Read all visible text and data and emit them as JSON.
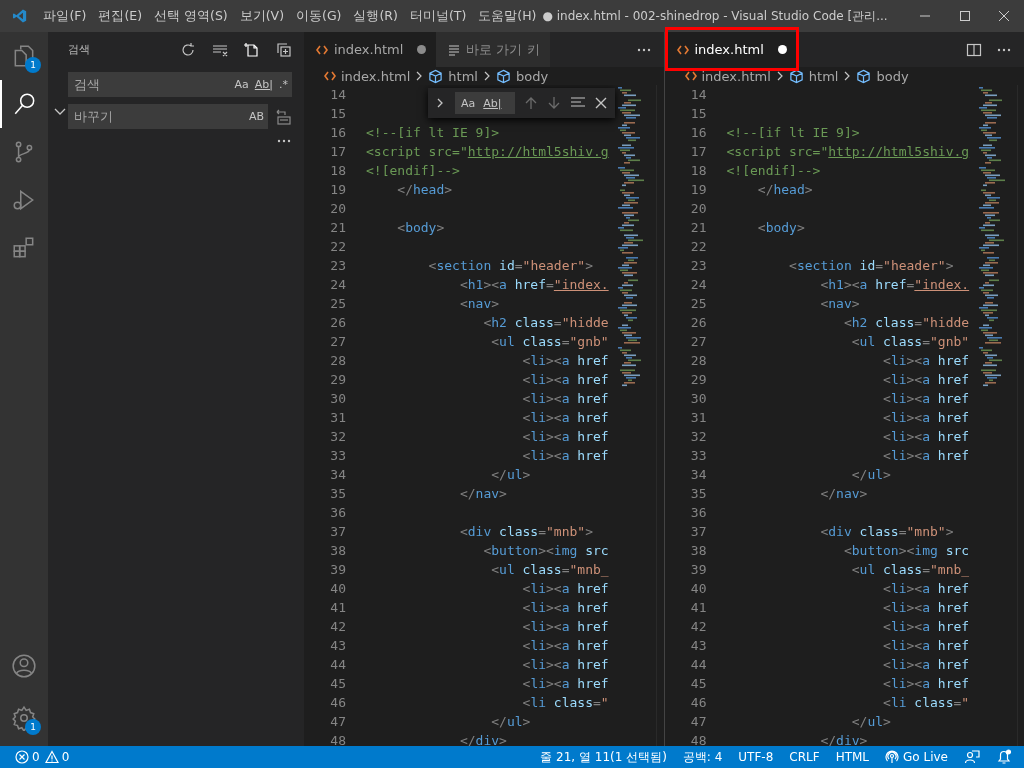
{
  "window": {
    "title": "● index.html - 002-shinedrop - Visual Studio Code [관리...",
    "menus": [
      "파일(F)",
      "편집(E)",
      "선택 영역(S)",
      "보기(V)",
      "이동(G)",
      "실행(R)",
      "터미널(T)",
      "도움말(H)"
    ]
  },
  "activity_bar": {
    "items": [
      {
        "kind": "explorer",
        "selected": false,
        "badge": "1"
      },
      {
        "kind": "search",
        "selected": true
      },
      {
        "kind": "source-control",
        "selected": false
      },
      {
        "kind": "run",
        "selected": false
      },
      {
        "kind": "extensions",
        "selected": false
      }
    ],
    "bottom": [
      {
        "kind": "account",
        "selected": false
      },
      {
        "kind": "settings",
        "selected": false,
        "badge": "1"
      }
    ]
  },
  "sidebar": {
    "title": "검색",
    "replace_expanded": true,
    "search": {
      "placeholder": "검색",
      "options": [
        "Aa",
        "Ab|",
        ".*"
      ]
    },
    "replace": {
      "placeholder": "바꾸기",
      "options": [
        "AB"
      ]
    }
  },
  "editor_groups": [
    {
      "focused": false,
      "tabs": [
        {
          "label": "index.html",
          "kind": "html",
          "selected": true,
          "dirty": true,
          "highlighted": false
        },
        {
          "label": "바로 가기 키",
          "kind": "shortcuts",
          "selected": false,
          "dirty": false,
          "highlighted": false
        }
      ],
      "breadcrumbs": [
        {
          "label": "index.html",
          "kind": "file"
        },
        {
          "label": "html",
          "kind": "element"
        },
        {
          "label": "body",
          "kind": "element"
        }
      ],
      "find_widget": {
        "expanded": false,
        "options": [
          "Aa",
          "Ab|"
        ]
      },
      "lines": [
        {
          "number": "14"
        },
        {
          "number": "15"
        },
        {
          "number": "16",
          "segments": [
            {
              "kind": "comment",
              "text": "<!--[if lt IE 9]>"
            }
          ]
        },
        {
          "number": "17",
          "segments": [
            {
              "kind": "comment",
              "text": "<script src=\""
            },
            {
              "kind": "link",
              "text": "http://html5shiv.g"
            }
          ]
        },
        {
          "number": "18",
          "segments": [
            {
              "kind": "comment",
              "text": "<![endif]-->"
            }
          ]
        },
        {
          "number": "19",
          "segments": [
            {
              "kind": "punct",
              "text": "    </"
            },
            {
              "kind": "tag",
              "text": "head"
            },
            {
              "kind": "punct",
              "text": ">"
            }
          ]
        },
        {
          "number": "20"
        },
        {
          "number": "21",
          "segments": [
            {
              "kind": "punct",
              "text": "    <"
            },
            {
              "kind": "tag",
              "text": "body"
            },
            {
              "kind": "punct",
              "text": ">"
            }
          ]
        },
        {
          "number": "22"
        },
        {
          "number": "23",
          "segments": [
            {
              "kind": "punct",
              "text": "        <"
            },
            {
              "kind": "tag",
              "text": "section"
            },
            {
              "kind": "attr",
              "text": " id"
            },
            {
              "kind": "punct",
              "text": "="
            },
            {
              "kind": "string",
              "text": "\"header\""
            },
            {
              "kind": "punct",
              "text": ">"
            }
          ]
        },
        {
          "number": "24",
          "segments": [
            {
              "kind": "punct",
              "text": "            <"
            },
            {
              "kind": "tag",
              "text": "h1"
            },
            {
              "kind": "punct",
              "text": "><"
            },
            {
              "kind": "tag",
              "text": "a"
            },
            {
              "kind": "attr",
              "text": " href"
            },
            {
              "kind": "punct",
              "text": "="
            },
            {
              "kind": "link-string",
              "text": "\"index."
            }
          ]
        },
        {
          "number": "25",
          "segments": [
            {
              "kind": "punct",
              "text": "            <"
            },
            {
              "kind": "tag",
              "text": "nav"
            },
            {
              "kind": "punct",
              "text": ">"
            }
          ]
        },
        {
          "number": "26",
          "segments": [
            {
              "kind": "punct",
              "text": "               <"
            },
            {
              "kind": "tag",
              "text": "h2"
            },
            {
              "kind": "attr",
              "text": " class"
            },
            {
              "kind": "punct",
              "text": "="
            },
            {
              "kind": "string",
              "text": "\"hidde"
            }
          ]
        },
        {
          "number": "27",
          "segments": [
            {
              "kind": "punct",
              "text": "                <"
            },
            {
              "kind": "tag",
              "text": "ul"
            },
            {
              "kind": "attr",
              "text": " class"
            },
            {
              "kind": "punct",
              "text": "="
            },
            {
              "kind": "string",
              "text": "\"gnb\""
            }
          ]
        },
        {
          "number": "28",
          "segments": [
            {
              "kind": "punct",
              "text": "                    <"
            },
            {
              "kind": "tag",
              "text": "li"
            },
            {
              "kind": "punct",
              "text": "><"
            },
            {
              "kind": "tag",
              "text": "a"
            },
            {
              "kind": "attr",
              "text": " href"
            }
          ]
        },
        {
          "number": "29",
          "segments": [
            {
              "kind": "punct",
              "text": "                    <"
            },
            {
              "kind": "tag",
              "text": "li"
            },
            {
              "kind": "punct",
              "text": "><"
            },
            {
              "kind": "tag",
              "text": "a"
            },
            {
              "kind": "attr",
              "text": " href"
            }
          ]
        },
        {
          "number": "30",
          "segments": [
            {
              "kind": "punct",
              "text": "                    <"
            },
            {
              "kind": "tag",
              "text": "li"
            },
            {
              "kind": "punct",
              "text": "><"
            },
            {
              "kind": "tag",
              "text": "a"
            },
            {
              "kind": "attr",
              "text": " href"
            }
          ]
        },
        {
          "number": "31",
          "segments": [
            {
              "kind": "punct",
              "text": "                    <"
            },
            {
              "kind": "tag",
              "text": "li"
            },
            {
              "kind": "punct",
              "text": "><"
            },
            {
              "kind": "tag",
              "text": "a"
            },
            {
              "kind": "attr",
              "text": " href"
            }
          ]
        },
        {
          "number": "32",
          "segments": [
            {
              "kind": "punct",
              "text": "                    <"
            },
            {
              "kind": "tag",
              "text": "li"
            },
            {
              "kind": "punct",
              "text": "><"
            },
            {
              "kind": "tag",
              "text": "a"
            },
            {
              "kind": "attr",
              "text": " href"
            }
          ]
        },
        {
          "number": "33",
          "segments": [
            {
              "kind": "punct",
              "text": "                    <"
            },
            {
              "kind": "tag",
              "text": "li"
            },
            {
              "kind": "punct",
              "text": "><"
            },
            {
              "kind": "tag",
              "text": "a"
            },
            {
              "kind": "attr",
              "text": " href"
            }
          ]
        },
        {
          "number": "34",
          "segments": [
            {
              "kind": "punct",
              "text": "                </"
            },
            {
              "kind": "tag",
              "text": "ul"
            },
            {
              "kind": "punct",
              "text": ">"
            }
          ]
        },
        {
          "number": "35",
          "segments": [
            {
              "kind": "punct",
              "text": "            </"
            },
            {
              "kind": "tag",
              "text": "nav"
            },
            {
              "kind": "punct",
              "text": ">"
            }
          ]
        },
        {
          "number": "36"
        },
        {
          "number": "37",
          "segments": [
            {
              "kind": "punct",
              "text": "            <"
            },
            {
              "kind": "tag",
              "text": "div"
            },
            {
              "kind": "attr",
              "text": " class"
            },
            {
              "kind": "punct",
              "text": "="
            },
            {
              "kind": "string",
              "text": "\"mnb\""
            },
            {
              "kind": "punct",
              "text": ">"
            }
          ]
        },
        {
          "number": "38",
          "segments": [
            {
              "kind": "punct",
              "text": "               <"
            },
            {
              "kind": "tag",
              "text": "button"
            },
            {
              "kind": "punct",
              "text": "><"
            },
            {
              "kind": "tag",
              "text": "img"
            },
            {
              "kind": "attr",
              "text": " src"
            }
          ]
        },
        {
          "number": "39",
          "segments": [
            {
              "kind": "punct",
              "text": "                <"
            },
            {
              "kind": "tag",
              "text": "ul"
            },
            {
              "kind": "attr",
              "text": " class"
            },
            {
              "kind": "punct",
              "text": "="
            },
            {
              "kind": "string",
              "text": "\"mnb_"
            }
          ]
        },
        {
          "number": "40",
          "segments": [
            {
              "kind": "punct",
              "text": "                    <"
            },
            {
              "kind": "tag",
              "text": "li"
            },
            {
              "kind": "punct",
              "text": "><"
            },
            {
              "kind": "tag",
              "text": "a"
            },
            {
              "kind": "attr",
              "text": " href"
            }
          ]
        },
        {
          "number": "41",
          "segments": [
            {
              "kind": "punct",
              "text": "                    <"
            },
            {
              "kind": "tag",
              "text": "li"
            },
            {
              "kind": "punct",
              "text": "><"
            },
            {
              "kind": "tag",
              "text": "a"
            },
            {
              "kind": "attr",
              "text": " href"
            }
          ]
        },
        {
          "number": "42",
          "segments": [
            {
              "kind": "punct",
              "text": "                    <"
            },
            {
              "kind": "tag",
              "text": "li"
            },
            {
              "kind": "punct",
              "text": "><"
            },
            {
              "kind": "tag",
              "text": "a"
            },
            {
              "kind": "attr",
              "text": " href"
            }
          ]
        },
        {
          "number": "43",
          "segments": [
            {
              "kind": "punct",
              "text": "                    <"
            },
            {
              "kind": "tag",
              "text": "li"
            },
            {
              "kind": "punct",
              "text": "><"
            },
            {
              "kind": "tag",
              "text": "a"
            },
            {
              "kind": "attr",
              "text": " href"
            }
          ]
        },
        {
          "number": "44",
          "segments": [
            {
              "kind": "punct",
              "text": "                    <"
            },
            {
              "kind": "tag",
              "text": "li"
            },
            {
              "kind": "punct",
              "text": "><"
            },
            {
              "kind": "tag",
              "text": "a"
            },
            {
              "kind": "attr",
              "text": " href"
            }
          ]
        },
        {
          "number": "45",
          "segments": [
            {
              "kind": "punct",
              "text": "                    <"
            },
            {
              "kind": "tag",
              "text": "li"
            },
            {
              "kind": "punct",
              "text": "><"
            },
            {
              "kind": "tag",
              "text": "a"
            },
            {
              "kind": "attr",
              "text": " href"
            }
          ]
        },
        {
          "number": "46",
          "segments": [
            {
              "kind": "punct",
              "text": "                    <"
            },
            {
              "kind": "tag",
              "text": "li"
            },
            {
              "kind": "attr",
              "text": " class"
            },
            {
              "kind": "punct",
              "text": "="
            },
            {
              "kind": "string",
              "text": "\""
            }
          ]
        },
        {
          "number": "47",
          "segments": [
            {
              "kind": "punct",
              "text": "                </"
            },
            {
              "kind": "tag",
              "text": "ul"
            },
            {
              "kind": "punct",
              "text": ">"
            }
          ]
        },
        {
          "number": "48",
          "segments": [
            {
              "kind": "punct",
              "text": "            </"
            },
            {
              "kind": "tag",
              "text": "div"
            },
            {
              "kind": "punct",
              "text": ">"
            }
          ]
        }
      ]
    },
    {
      "focused": true,
      "tabs": [
        {
          "label": "index.html",
          "kind": "html",
          "selected": true,
          "dirty": true,
          "highlighted": true
        }
      ],
      "breadcrumbs": [
        {
          "label": "index.html",
          "kind": "file"
        },
        {
          "label": "html",
          "kind": "element"
        },
        {
          "label": "body",
          "kind": "element"
        }
      ],
      "lines": [
        {
          "number": "14"
        },
        {
          "number": "15"
        },
        {
          "number": "16",
          "segments": [
            {
              "kind": "comment",
              "text": "<!--[if lt IE 9]>"
            }
          ]
        },
        {
          "number": "17",
          "segments": [
            {
              "kind": "comment",
              "text": "<script src=\""
            },
            {
              "kind": "link",
              "text": "http://html5shiv.g"
            }
          ]
        },
        {
          "number": "18",
          "segments": [
            {
              "kind": "comment",
              "text": "<![endif]-->"
            }
          ]
        },
        {
          "number": "19",
          "segments": [
            {
              "kind": "punct",
              "text": "    </"
            },
            {
              "kind": "tag",
              "text": "head"
            },
            {
              "kind": "punct",
              "text": ">"
            }
          ]
        },
        {
          "number": "20"
        },
        {
          "number": "21",
          "segments": [
            {
              "kind": "punct",
              "text": "    <"
            },
            {
              "kind": "tag",
              "text": "body"
            },
            {
              "kind": "punct",
              "text": ">"
            }
          ]
        },
        {
          "number": "22"
        },
        {
          "number": "23",
          "segments": [
            {
              "kind": "punct",
              "text": "        <"
            },
            {
              "kind": "tag",
              "text": "section"
            },
            {
              "kind": "attr",
              "text": " id"
            },
            {
              "kind": "punct",
              "text": "="
            },
            {
              "kind": "string",
              "text": "\"header\""
            },
            {
              "kind": "punct",
              "text": ">"
            }
          ]
        },
        {
          "number": "24",
          "segments": [
            {
              "kind": "punct",
              "text": "            <"
            },
            {
              "kind": "tag",
              "text": "h1"
            },
            {
              "kind": "punct",
              "text": "><"
            },
            {
              "kind": "tag",
              "text": "a"
            },
            {
              "kind": "attr",
              "text": " href"
            },
            {
              "kind": "punct",
              "text": "="
            },
            {
              "kind": "link-string",
              "text": "\"index."
            }
          ]
        },
        {
          "number": "25",
          "segments": [
            {
              "kind": "punct",
              "text": "            <"
            },
            {
              "kind": "tag",
              "text": "nav"
            },
            {
              "kind": "punct",
              "text": ">"
            }
          ]
        },
        {
          "number": "26",
          "segments": [
            {
              "kind": "punct",
              "text": "               <"
            },
            {
              "kind": "tag",
              "text": "h2"
            },
            {
              "kind": "attr",
              "text": " class"
            },
            {
              "kind": "punct",
              "text": "="
            },
            {
              "kind": "string",
              "text": "\"hidde"
            }
          ]
        },
        {
          "number": "27",
          "segments": [
            {
              "kind": "punct",
              "text": "                <"
            },
            {
              "kind": "tag",
              "text": "ul"
            },
            {
              "kind": "attr",
              "text": " class"
            },
            {
              "kind": "punct",
              "text": "="
            },
            {
              "kind": "string",
              "text": "\"gnb\""
            }
          ]
        },
        {
          "number": "28",
          "segments": [
            {
              "kind": "punct",
              "text": "                    <"
            },
            {
              "kind": "tag",
              "text": "li"
            },
            {
              "kind": "punct",
              "text": "><"
            },
            {
              "kind": "tag",
              "text": "a"
            },
            {
              "kind": "attr",
              "text": " href"
            }
          ]
        },
        {
          "number": "29",
          "segments": [
            {
              "kind": "punct",
              "text": "                    <"
            },
            {
              "kind": "tag",
              "text": "li"
            },
            {
              "kind": "punct",
              "text": "><"
            },
            {
              "kind": "tag",
              "text": "a"
            },
            {
              "kind": "attr",
              "text": " href"
            }
          ]
        },
        {
          "number": "30",
          "segments": [
            {
              "kind": "punct",
              "text": "                    <"
            },
            {
              "kind": "tag",
              "text": "li"
            },
            {
              "kind": "punct",
              "text": "><"
            },
            {
              "kind": "tag",
              "text": "a"
            },
            {
              "kind": "attr",
              "text": " href"
            }
          ]
        },
        {
          "number": "31",
          "segments": [
            {
              "kind": "punct",
              "text": "                    <"
            },
            {
              "kind": "tag",
              "text": "li"
            },
            {
              "kind": "punct",
              "text": "><"
            },
            {
              "kind": "tag",
              "text": "a"
            },
            {
              "kind": "attr",
              "text": " href"
            }
          ]
        },
        {
          "number": "32",
          "segments": [
            {
              "kind": "punct",
              "text": "                    <"
            },
            {
              "kind": "tag",
              "text": "li"
            },
            {
              "kind": "punct",
              "text": "><"
            },
            {
              "kind": "tag",
              "text": "a"
            },
            {
              "kind": "attr",
              "text": " href"
            }
          ]
        },
        {
          "number": "33",
          "segments": [
            {
              "kind": "punct",
              "text": "                    <"
            },
            {
              "kind": "tag",
              "text": "li"
            },
            {
              "kind": "punct",
              "text": "><"
            },
            {
              "kind": "tag",
              "text": "a"
            },
            {
              "kind": "attr",
              "text": " href"
            }
          ]
        },
        {
          "number": "34",
          "segments": [
            {
              "kind": "punct",
              "text": "                </"
            },
            {
              "kind": "tag",
              "text": "ul"
            },
            {
              "kind": "punct",
              "text": ">"
            }
          ]
        },
        {
          "number": "35",
          "segments": [
            {
              "kind": "punct",
              "text": "            </"
            },
            {
              "kind": "tag",
              "text": "nav"
            },
            {
              "kind": "punct",
              "text": ">"
            }
          ]
        },
        {
          "number": "36"
        },
        {
          "number": "37",
          "segments": [
            {
              "kind": "punct",
              "text": "            <"
            },
            {
              "kind": "tag",
              "text": "div"
            },
            {
              "kind": "attr",
              "text": " class"
            },
            {
              "kind": "punct",
              "text": "="
            },
            {
              "kind": "string",
              "text": "\"mnb\""
            },
            {
              "kind": "punct",
              "text": ">"
            }
          ]
        },
        {
          "number": "38",
          "segments": [
            {
              "kind": "punct",
              "text": "               <"
            },
            {
              "kind": "tag",
              "text": "button"
            },
            {
              "kind": "punct",
              "text": "><"
            },
            {
              "kind": "tag",
              "text": "img"
            },
            {
              "kind": "attr",
              "text": " src"
            }
          ]
        },
        {
          "number": "39",
          "segments": [
            {
              "kind": "punct",
              "text": "                <"
            },
            {
              "kind": "tag",
              "text": "ul"
            },
            {
              "kind": "attr",
              "text": " class"
            },
            {
              "kind": "punct",
              "text": "="
            },
            {
              "kind": "string",
              "text": "\"mnb_"
            }
          ]
        },
        {
          "number": "40",
          "segments": [
            {
              "kind": "punct",
              "text": "                    <"
            },
            {
              "kind": "tag",
              "text": "li"
            },
            {
              "kind": "punct",
              "text": "><"
            },
            {
              "kind": "tag",
              "text": "a"
            },
            {
              "kind": "attr",
              "text": " href"
            }
          ]
        },
        {
          "number": "41",
          "segments": [
            {
              "kind": "punct",
              "text": "                    <"
            },
            {
              "kind": "tag",
              "text": "li"
            },
            {
              "kind": "punct",
              "text": "><"
            },
            {
              "kind": "tag",
              "text": "a"
            },
            {
              "kind": "attr",
              "text": " href"
            }
          ]
        },
        {
          "number": "42",
          "segments": [
            {
              "kind": "punct",
              "text": "                    <"
            },
            {
              "kind": "tag",
              "text": "li"
            },
            {
              "kind": "punct",
              "text": "><"
            },
            {
              "kind": "tag",
              "text": "a"
            },
            {
              "kind": "attr",
              "text": " href"
            }
          ]
        },
        {
          "number": "43",
          "segments": [
            {
              "kind": "punct",
              "text": "                    <"
            },
            {
              "kind": "tag",
              "text": "li"
            },
            {
              "kind": "punct",
              "text": "><"
            },
            {
              "kind": "tag",
              "text": "a"
            },
            {
              "kind": "attr",
              "text": " href"
            }
          ]
        },
        {
          "number": "44",
          "segments": [
            {
              "kind": "punct",
              "text": "                    <"
            },
            {
              "kind": "tag",
              "text": "li"
            },
            {
              "kind": "punct",
              "text": "><"
            },
            {
              "kind": "tag",
              "text": "a"
            },
            {
              "kind": "attr",
              "text": " href"
            }
          ]
        },
        {
          "number": "45",
          "segments": [
            {
              "kind": "punct",
              "text": "                    <"
            },
            {
              "kind": "tag",
              "text": "li"
            },
            {
              "kind": "punct",
              "text": "><"
            },
            {
              "kind": "tag",
              "text": "a"
            },
            {
              "kind": "attr",
              "text": " href"
            }
          ]
        },
        {
          "number": "46",
          "segments": [
            {
              "kind": "punct",
              "text": "                    <"
            },
            {
              "kind": "tag",
              "text": "li"
            },
            {
              "kind": "attr",
              "text": " class"
            },
            {
              "kind": "punct",
              "text": "="
            },
            {
              "kind": "string",
              "text": "\""
            }
          ]
        },
        {
          "number": "47",
          "segments": [
            {
              "kind": "punct",
              "text": "                </"
            },
            {
              "kind": "tag",
              "text": "ul"
            },
            {
              "kind": "punct",
              "text": ">"
            }
          ]
        },
        {
          "number": "48",
          "segments": [
            {
              "kind": "punct",
              "text": "            </"
            },
            {
              "kind": "tag",
              "text": "div"
            },
            {
              "kind": "punct",
              "text": ">"
            }
          ]
        }
      ]
    }
  ],
  "status_bar": {
    "left": [
      {
        "kind": "errors",
        "text": "0"
      },
      {
        "kind": "warnings",
        "text": "0"
      }
    ],
    "right": [
      {
        "kind": "text",
        "text": "줄 21, 열 11(1 선택됨)"
      },
      {
        "kind": "text",
        "text": "공백: 4"
      },
      {
        "kind": "text",
        "text": "UTF-8"
      },
      {
        "kind": "text",
        "text": "CRLF"
      },
      {
        "kind": "text",
        "text": "HTML"
      },
      {
        "kind": "go-live",
        "text": "Go Live"
      },
      {
        "kind": "feedback"
      },
      {
        "kind": "notifications"
      }
    ]
  }
}
